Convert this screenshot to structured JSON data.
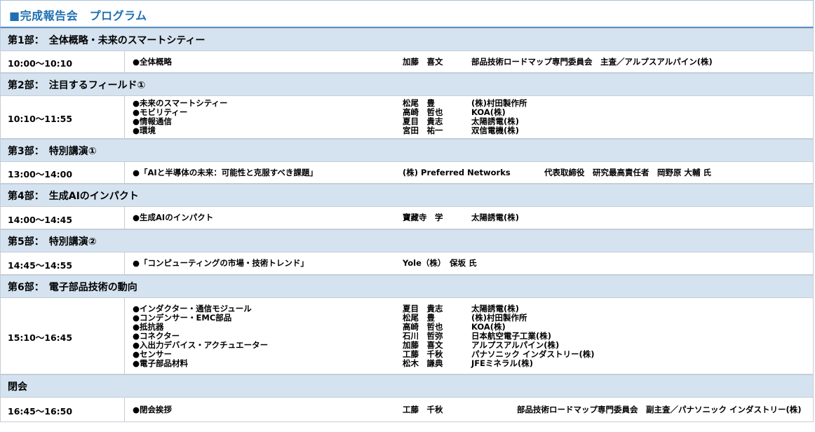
{
  "title": "■完成報告会　プログラム",
  "sections": [
    {
      "header": "第1部：　全体概略・未来のスマートシティー",
      "time": "10:00～10:10",
      "items": [
        {
          "topic": "●全体概略",
          "speaker": "加藤　喜文",
          "org": "部品技術ロードマップ専門委員会　主査／アルプスアルパイン(株)"
        }
      ]
    },
    {
      "header": "第2部：　注目するフィールド①",
      "time": "10:10～11:55",
      "items": [
        {
          "topic": "●未来のスマートシティー",
          "speaker": "松尾　豊",
          "org": "(株)村田製作所"
        },
        {
          "topic": "●モビリティー",
          "speaker": "高崎　哲也",
          "org": "KOA(株)"
        },
        {
          "topic": "●情報通信",
          "speaker": "夏目　貴志",
          "org": "太陽誘電(株)"
        },
        {
          "topic": "●環境",
          "speaker": "宮田　祐一",
          "org": "双信電機(株)"
        }
      ]
    },
    {
      "header": "第3部：　特別講演①",
      "time": "13:00～14:00",
      "items": [
        {
          "topic": "●「AIと半導体の未来：可能性と克服すべき課題」",
          "speaker": "(株) Preferred Networks",
          "org": "代表取締役　研究最高責任者　岡野原 大輔 氏"
        }
      ]
    },
    {
      "header": "第4部：　生成AIのインパクト",
      "time": "14:00～14:45",
      "items": [
        {
          "topic": "●生成AIのインパクト",
          "speaker": "寶藏寺　学",
          "org": "太陽誘電(株)"
        }
      ]
    },
    {
      "header": "第5部：　特別講演②",
      "time": "14:45～14:55",
      "items": [
        {
          "topic": "●「コンピューティングの市場・技術トレンド」",
          "speaker": "Yole（株）　保坂 氏",
          "org": ""
        }
      ]
    },
    {
      "header": "第6部：　電子部品技術の動向",
      "time": "15:10～16:45",
      "items": [
        {
          "topic": "●インダクター・通信モジュール",
          "speaker": "夏目　貴志",
          "org": "太陽誘電(株)"
        },
        {
          "topic": "●コンデンサー・EMC部品",
          "speaker": "松尾　豊",
          "org": "(株)村田製作所"
        },
        {
          "topic": "●抵抗器",
          "speaker": "高崎　哲也",
          "org": "KOA(株)"
        },
        {
          "topic": "●コネクター",
          "speaker": "石川　哲弥",
          "org": "日本航空電子工業(株)"
        },
        {
          "topic": "●入出力デバイス・アクチュエーター",
          "speaker": "加藤　喜文",
          "org": "アルプスアルパイン(株)"
        },
        {
          "topic": "●センサー",
          "speaker": "工藤　千秋",
          "org": "パナソニック インダストリー(株)"
        },
        {
          "topic": "●電子部品材料",
          "speaker": "松木　謙典",
          "org": "JFEミネラル(株)"
        }
      ]
    },
    {
      "header": "閉会",
      "time": "16:45～16:50",
      "items": [
        {
          "topic": "●閉会挨拶",
          "speaker": "工藤　千秋",
          "org": "部品技術ロードマップ専門委員会　副主査／パナソニック インダストリー(株)"
        }
      ]
    }
  ]
}
